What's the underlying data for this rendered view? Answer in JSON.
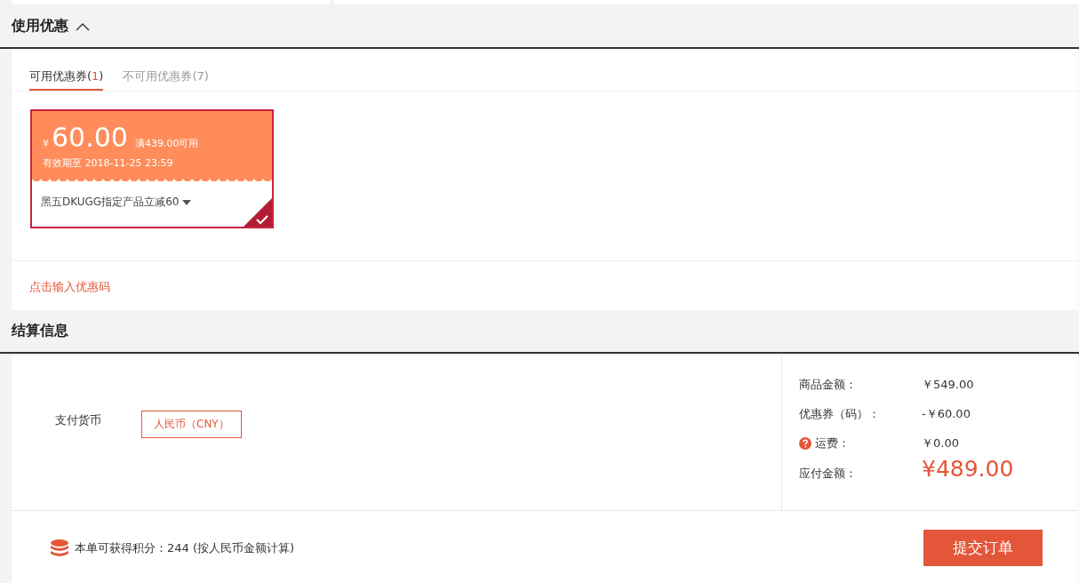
{
  "coupon_section": {
    "title": "使用优惠",
    "expanded": true,
    "tabs": [
      {
        "selected": true,
        "parts": [
          {
            "text": "可用优惠券(",
            "kind": "label"
          },
          {
            "text": "1",
            "kind": "count"
          },
          {
            "text": ")",
            "kind": "label"
          }
        ]
      },
      {
        "selected": false,
        "parts": [
          {
            "text": "不可用优惠券(7)",
            "kind": "label"
          }
        ]
      }
    ],
    "coupons": [
      {
        "currency": "¥",
        "amount": "60.00",
        "condition": "满439.00可用",
        "validity": "有效期至  2018-11-25 23:59",
        "description": "黑五DKUGG指定产品立减60",
        "selected": true
      }
    ],
    "code_link": "点击输入优惠码"
  },
  "settlement": {
    "title": "结算信息",
    "currency_label": "支付货币",
    "currency_option": "人民币（CNY）",
    "summary": [
      {
        "kind": "plain",
        "label": "商品金额：",
        "value": "￥549.00"
      },
      {
        "kind": "plain",
        "label": "优惠券（码）：",
        "value": "-￥60.00"
      },
      {
        "kind": "help",
        "label": "运费：",
        "value": "￥0.00"
      },
      {
        "kind": "total",
        "label": "应付金额：",
        "value": "¥489.00"
      }
    ],
    "points_note": "本单可获得积分：244  (按人民币金额计算)",
    "submit": "提交订单"
  }
}
